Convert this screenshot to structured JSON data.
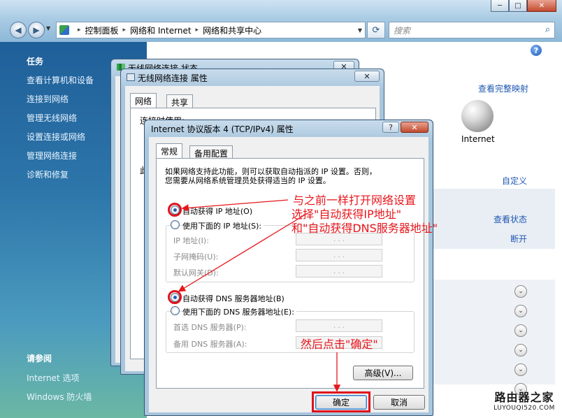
{
  "explorer": {
    "window_controls": [
      "─",
      "□",
      "✕"
    ],
    "address": {
      "crumbs": [
        "控制面板",
        "网络和 Internet",
        "网络和共享中心"
      ],
      "separator": "▸"
    },
    "search": {
      "placeholder": "搜索"
    },
    "sidebar": {
      "tasks_heading": "任务",
      "tasks": [
        "查看计算机和设备",
        "连接到网络",
        "管理无线网络",
        "设置连接或网络",
        "管理网络连接",
        "诊断和修复"
      ],
      "see_also_heading": "请参阅",
      "see_also": [
        "Internet 选项",
        "Windows 防火墙"
      ]
    },
    "main": {
      "help": "?",
      "view_full_map": "查看完整映射",
      "internet_label": "Internet",
      "customize": "自定义",
      "view_status": "查看状态",
      "disconnect": "断开",
      "chevron": "⌄"
    }
  },
  "status_dialog": {
    "title": "无线网络连接 状态"
  },
  "props_dialog": {
    "title": "无线网络连接 属性",
    "tabs": [
      "网络",
      "共享"
    ],
    "connect_using": "连接时使用:",
    "partial_label": "此"
  },
  "ipv4_dialog": {
    "title": "Internet 协议版本 4 (TCP/IPv4) 属性",
    "help": "?",
    "close": "✕",
    "tabs": [
      "常规",
      "备用配置"
    ],
    "description": [
      "如果网络支持此功能，则可以获取自动指派的 IP 设置。否则，",
      "您需要从网络系统管理员处获得适当的 IP 设置。"
    ],
    "auto_ip": "自动获得 IP 地址(O)",
    "manual_ip": "使用下面的 IP 地址(S):",
    "ip_address": "IP 地址(I):",
    "subnet_mask": "子网掩码(U):",
    "gateway": "默认网关(D):",
    "auto_dns": "自动获得 DNS 服务器地址(B)",
    "manual_dns": "使用下面的 DNS 服务器地址(E):",
    "preferred_dns": "首选 DNS 服务器(P):",
    "alternate_dns": "备用 DNS 服务器(A):",
    "ip_dots": ".   .   .",
    "advanced": "高级(V)...",
    "ok": "确定",
    "cancel": "取消"
  },
  "annotations": {
    "line1": "与之前一样打开网络设置",
    "line2": "选择\"自动获得IP地址\"",
    "line3": "和\"自动获得DNS服务器地址\"",
    "line4": "然后点击\"确定\"",
    "color": "#e8161c"
  },
  "watermark": {
    "brand": "路由器之家",
    "url": "LUYOUQI520.COM"
  }
}
